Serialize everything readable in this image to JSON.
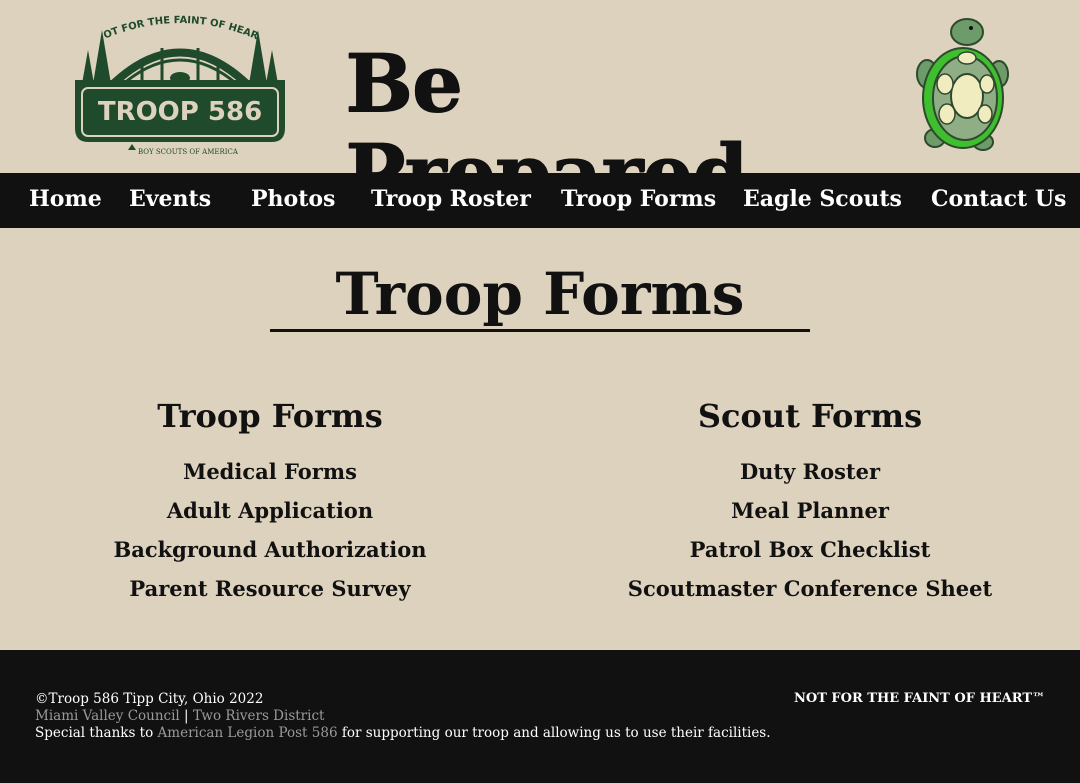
{
  "header": {
    "site_title": "Be Prepared",
    "logo": {
      "arc_text": "NOT FOR THE FAINT OF HEART",
      "badge_text": "TROOP 586",
      "bsa_text": "BOY SCOUTS OF AMERICA",
      "colors": {
        "green": "#1f4a2c",
        "cream": "#ddd2bd"
      }
    },
    "mascot_icon": "turtle-mascot"
  },
  "nav": {
    "items": [
      {
        "label": "Home"
      },
      {
        "label": "Events"
      },
      {
        "label": "Photos"
      },
      {
        "label": "Troop Roster"
      },
      {
        "label": "Troop Forms"
      },
      {
        "label": "Eagle Scouts"
      },
      {
        "label": "Contact Us"
      }
    ]
  },
  "main": {
    "page_title": "Troop Forms",
    "troop_forms": {
      "heading": "Troop Forms",
      "links": [
        "Medical Forms",
        "Adult Application",
        "Background Authorization",
        "Parent Resource Survey"
      ]
    },
    "scout_forms": {
      "heading": "Scout Forms",
      "links": [
        "Duty Roster",
        "Meal Planner",
        "Patrol Box Checklist",
        "Scoutmaster Conference Sheet"
      ]
    }
  },
  "footer": {
    "copyright": "©Troop 586 Tipp City, Ohio 2022",
    "council_link": "Miami Valley Council",
    "separator": "|",
    "district_link": "Two Rivers District",
    "thanks_prefix": "Special thanks to ",
    "thanks_link": "American Legion Post 586",
    "thanks_suffix": " for supporting our troop and allowing us to use their facilities.",
    "tagline": "NOT FOR THE FAINT OF HEART™"
  },
  "colors": {
    "background": "#ddd2bd",
    "nav_background": "#111111",
    "footer_background": "#111111",
    "muted_link": "#9a9a9a"
  }
}
